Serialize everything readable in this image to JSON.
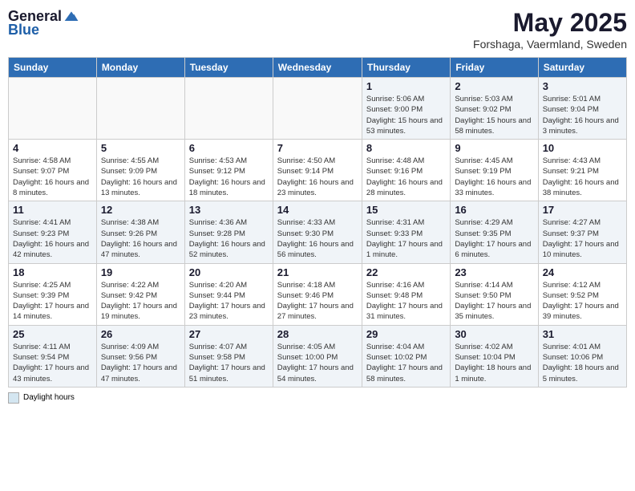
{
  "logo": {
    "general": "General",
    "blue": "Blue"
  },
  "title": "May 2025",
  "subtitle": "Forshaga, Vaermland, Sweden",
  "headers": [
    "Sunday",
    "Monday",
    "Tuesday",
    "Wednesday",
    "Thursday",
    "Friday",
    "Saturday"
  ],
  "weeks": [
    [
      {
        "num": "",
        "info": ""
      },
      {
        "num": "",
        "info": ""
      },
      {
        "num": "",
        "info": ""
      },
      {
        "num": "",
        "info": ""
      },
      {
        "num": "1",
        "info": "Sunrise: 5:06 AM\nSunset: 9:00 PM\nDaylight: 15 hours and 53 minutes."
      },
      {
        "num": "2",
        "info": "Sunrise: 5:03 AM\nSunset: 9:02 PM\nDaylight: 15 hours and 58 minutes."
      },
      {
        "num": "3",
        "info": "Sunrise: 5:01 AM\nSunset: 9:04 PM\nDaylight: 16 hours and 3 minutes."
      }
    ],
    [
      {
        "num": "4",
        "info": "Sunrise: 4:58 AM\nSunset: 9:07 PM\nDaylight: 16 hours and 8 minutes."
      },
      {
        "num": "5",
        "info": "Sunrise: 4:55 AM\nSunset: 9:09 PM\nDaylight: 16 hours and 13 minutes."
      },
      {
        "num": "6",
        "info": "Sunrise: 4:53 AM\nSunset: 9:12 PM\nDaylight: 16 hours and 18 minutes."
      },
      {
        "num": "7",
        "info": "Sunrise: 4:50 AM\nSunset: 9:14 PM\nDaylight: 16 hours and 23 minutes."
      },
      {
        "num": "8",
        "info": "Sunrise: 4:48 AM\nSunset: 9:16 PM\nDaylight: 16 hours and 28 minutes."
      },
      {
        "num": "9",
        "info": "Sunrise: 4:45 AM\nSunset: 9:19 PM\nDaylight: 16 hours and 33 minutes."
      },
      {
        "num": "10",
        "info": "Sunrise: 4:43 AM\nSunset: 9:21 PM\nDaylight: 16 hours and 38 minutes."
      }
    ],
    [
      {
        "num": "11",
        "info": "Sunrise: 4:41 AM\nSunset: 9:23 PM\nDaylight: 16 hours and 42 minutes."
      },
      {
        "num": "12",
        "info": "Sunrise: 4:38 AM\nSunset: 9:26 PM\nDaylight: 16 hours and 47 minutes."
      },
      {
        "num": "13",
        "info": "Sunrise: 4:36 AM\nSunset: 9:28 PM\nDaylight: 16 hours and 52 minutes."
      },
      {
        "num": "14",
        "info": "Sunrise: 4:33 AM\nSunset: 9:30 PM\nDaylight: 16 hours and 56 minutes."
      },
      {
        "num": "15",
        "info": "Sunrise: 4:31 AM\nSunset: 9:33 PM\nDaylight: 17 hours and 1 minute."
      },
      {
        "num": "16",
        "info": "Sunrise: 4:29 AM\nSunset: 9:35 PM\nDaylight: 17 hours and 6 minutes."
      },
      {
        "num": "17",
        "info": "Sunrise: 4:27 AM\nSunset: 9:37 PM\nDaylight: 17 hours and 10 minutes."
      }
    ],
    [
      {
        "num": "18",
        "info": "Sunrise: 4:25 AM\nSunset: 9:39 PM\nDaylight: 17 hours and 14 minutes."
      },
      {
        "num": "19",
        "info": "Sunrise: 4:22 AM\nSunset: 9:42 PM\nDaylight: 17 hours and 19 minutes."
      },
      {
        "num": "20",
        "info": "Sunrise: 4:20 AM\nSunset: 9:44 PM\nDaylight: 17 hours and 23 minutes."
      },
      {
        "num": "21",
        "info": "Sunrise: 4:18 AM\nSunset: 9:46 PM\nDaylight: 17 hours and 27 minutes."
      },
      {
        "num": "22",
        "info": "Sunrise: 4:16 AM\nSunset: 9:48 PM\nDaylight: 17 hours and 31 minutes."
      },
      {
        "num": "23",
        "info": "Sunrise: 4:14 AM\nSunset: 9:50 PM\nDaylight: 17 hours and 35 minutes."
      },
      {
        "num": "24",
        "info": "Sunrise: 4:12 AM\nSunset: 9:52 PM\nDaylight: 17 hours and 39 minutes."
      }
    ],
    [
      {
        "num": "25",
        "info": "Sunrise: 4:11 AM\nSunset: 9:54 PM\nDaylight: 17 hours and 43 minutes."
      },
      {
        "num": "26",
        "info": "Sunrise: 4:09 AM\nSunset: 9:56 PM\nDaylight: 17 hours and 47 minutes."
      },
      {
        "num": "27",
        "info": "Sunrise: 4:07 AM\nSunset: 9:58 PM\nDaylight: 17 hours and 51 minutes."
      },
      {
        "num": "28",
        "info": "Sunrise: 4:05 AM\nSunset: 10:00 PM\nDaylight: 17 hours and 54 minutes."
      },
      {
        "num": "29",
        "info": "Sunrise: 4:04 AM\nSunset: 10:02 PM\nDaylight: 17 hours and 58 minutes."
      },
      {
        "num": "30",
        "info": "Sunrise: 4:02 AM\nSunset: 10:04 PM\nDaylight: 18 hours and 1 minute."
      },
      {
        "num": "31",
        "info": "Sunrise: 4:01 AM\nSunset: 10:06 PM\nDaylight: 18 hours and 5 minutes."
      }
    ]
  ],
  "legend": {
    "daylight_label": "Daylight hours"
  }
}
